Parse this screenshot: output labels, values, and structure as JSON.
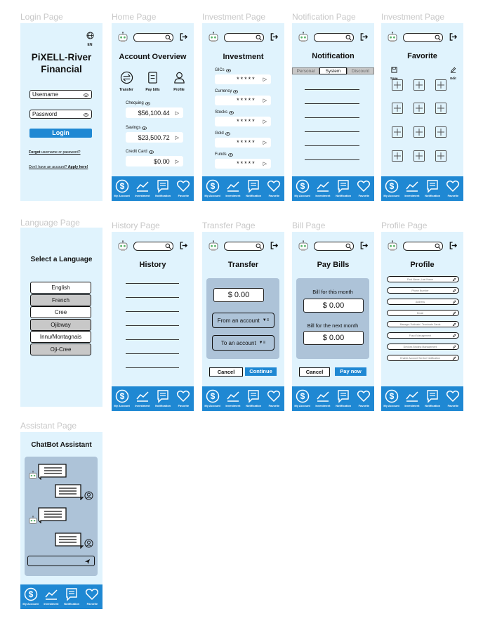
{
  "frames": {
    "login": {
      "label": "Login Page",
      "lang_badge": "EN",
      "brand_line1": "PiXELL-River",
      "brand_line2": "Financial",
      "username_placeholder": "Username",
      "password_placeholder": "Password",
      "login_button": "Login",
      "forgot_prefix": "Forgot ",
      "forgot_link": "username or password?",
      "signup_prefix": "Don't have an account? ",
      "signup_link": "Apply here!"
    },
    "home": {
      "label": "Home Page",
      "title": "Account Overview",
      "actions": [
        "Transfer",
        "Pay bills",
        "Profile"
      ],
      "accounts": [
        {
          "name": "Chequing",
          "value": "$56,100.44"
        },
        {
          "name": "Savings",
          "value": "$23,500.72"
        },
        {
          "name": "Credit Card",
          "value": "$0.00"
        }
      ]
    },
    "investment": {
      "label": "Investment Page",
      "title": "Investment",
      "items": [
        {
          "name": "GICs",
          "value": "*****"
        },
        {
          "name": "Currency",
          "value": "*****"
        },
        {
          "name": "Stocks",
          "value": "*****"
        },
        {
          "name": "Gold",
          "value": "*****"
        },
        {
          "name": "Funds",
          "value": "*****"
        }
      ]
    },
    "notification": {
      "label": "Notification Page",
      "title": "Notification",
      "tabs": [
        "Personal",
        "System",
        "Discount"
      ],
      "active_tab": "System"
    },
    "favorite": {
      "label": "Investment Page",
      "title": "Favorite",
      "save_label": "Save",
      "edit_label": "Edit"
    },
    "language": {
      "label": "Language Page",
      "title": "Select a Language",
      "options": [
        "English",
        "French",
        "Cree",
        "Ojibway",
        "Innu/Montagnais",
        "Oji-Cree"
      ]
    },
    "history": {
      "label": "History Page",
      "title": "History"
    },
    "transfer": {
      "label": "Transfer Page",
      "title": "Transfer",
      "amount": "$ 0.00",
      "from_label": "From an account",
      "to_label": "To an account",
      "cancel": "Cancel",
      "continue": "Continue"
    },
    "bill": {
      "label": "Bill Page",
      "title": "Pay Bills",
      "this_month_label": "Bill for this month",
      "this_month_amount": "$ 0.00",
      "next_month_label": "Bill for the next month",
      "next_month_amount": "$ 0.00",
      "cancel": "Cancel",
      "pay_now": "Pay now"
    },
    "profile": {
      "label": "Profile Page",
      "title": "Profile",
      "fields": [
        "First Name, Last Name",
        "Phone Number",
        "Address",
        "Email",
        "Manage / Activate / Terminate Cards",
        "Fraud Management",
        "Devices Binding Management",
        "Enable Account Service Notification"
      ]
    },
    "assistant": {
      "label": "Assistant Page",
      "title": "ChatBot Assistant"
    }
  },
  "nav": {
    "items": [
      "My Account",
      "Investment",
      "Notification",
      "Favorite"
    ]
  },
  "colors": {
    "frame_bg": "#e0f3fd",
    "nav_bg": "#1f88d3",
    "primary": "#1f88d3",
    "panel": "#adc3d8",
    "label_grey": "#c8c8c8"
  }
}
